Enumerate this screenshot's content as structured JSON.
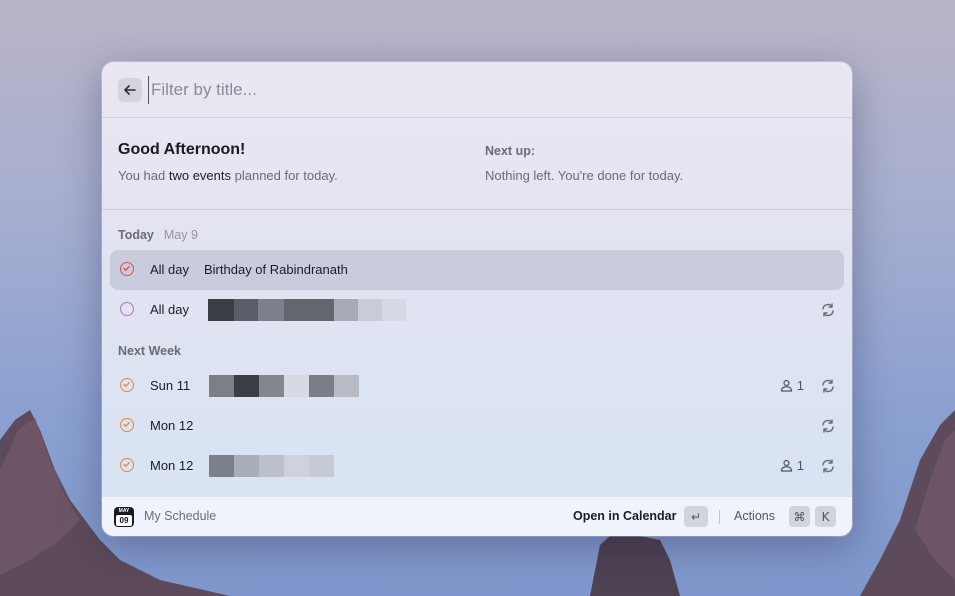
{
  "search": {
    "placeholder": "Filter by title..."
  },
  "summary": {
    "greeting": "Good Afternoon!",
    "sub_prefix": "You had ",
    "sub_emphasis": "two events",
    "sub_suffix": " planned for today.",
    "next_up_title": "Next up:",
    "next_up_text": "Nothing left. You're done for today."
  },
  "sections": [
    {
      "label": "Today",
      "date": "May 9"
    },
    {
      "label": "Next Week",
      "date": ""
    }
  ],
  "events": [
    {
      "when": "All day",
      "title": "Birthday of Rabindranath",
      "check_color": "#d9534f",
      "checked": true,
      "selected": true,
      "repeat": false,
      "attendees": ""
    },
    {
      "when": "All day",
      "title": "",
      "check_color": "#b56fd6",
      "checked": false,
      "selected": false,
      "repeat": true,
      "attendees": ""
    },
    {
      "when": "Sun 11",
      "title": "",
      "check_color": "#e08a3c",
      "checked": true,
      "selected": false,
      "repeat": true,
      "attendees": "1"
    },
    {
      "when": "Mon 12",
      "title": "",
      "check_color": "#e08a3c",
      "checked": true,
      "selected": false,
      "repeat": true,
      "attendees": ""
    },
    {
      "when": "Mon 12",
      "title": "",
      "check_color": "#e08a3c",
      "checked": true,
      "selected": false,
      "repeat": true,
      "attendees": "1"
    }
  ],
  "footer": {
    "calendar_icon_month": "MAY",
    "calendar_icon_day": "09",
    "app_name": "My Schedule",
    "primary_action": "Open in Calendar",
    "primary_key": "↵",
    "actions_label": "Actions",
    "actions_key_1": "⌘",
    "actions_key_2": "K"
  },
  "icons": {
    "back": "arrow-left-icon",
    "repeat": "repeat-icon",
    "person": "person-icon",
    "check": "check-circle-icon"
  }
}
